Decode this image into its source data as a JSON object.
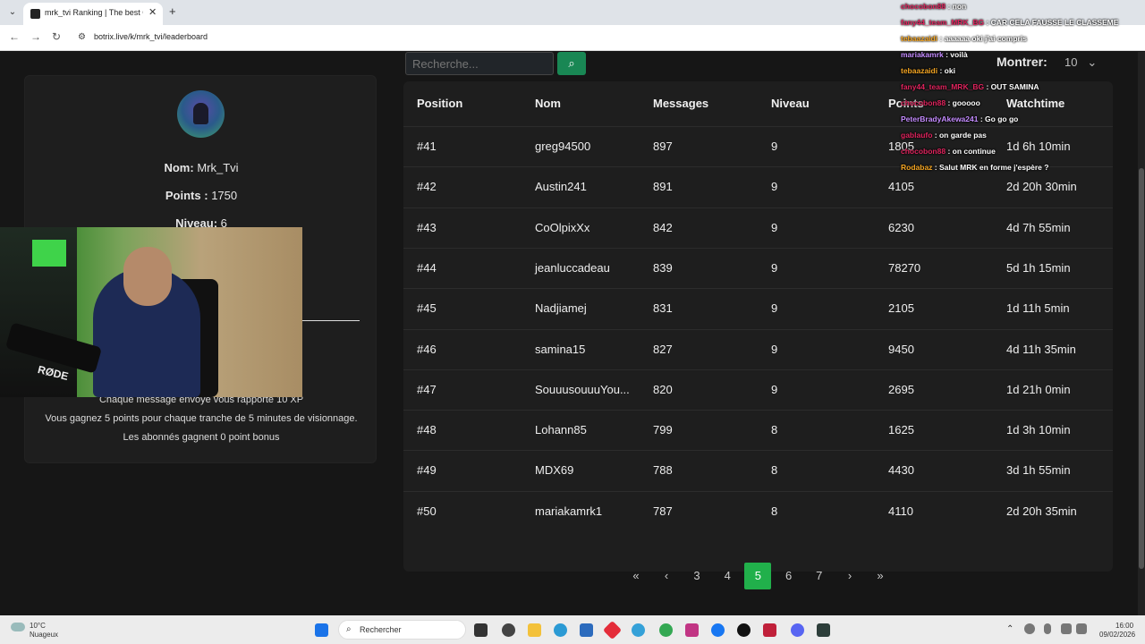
{
  "browser": {
    "tab_title": "mrk_tvi Ranking | The best Cha",
    "tab_close": "✕",
    "new_tab": "+",
    "url": "botrix.live/k/mrk_tvi/leaderboard"
  },
  "search": {
    "placeholder": "Recherche..."
  },
  "show": {
    "label": "Montrer:",
    "value": "10"
  },
  "profile": {
    "name_label": "Nom:",
    "name_value": "Mrk_Tvi",
    "points_label": "Points :",
    "points_value": "1750",
    "level_label": "Niveau:",
    "level_value": "6",
    "info_lines": [
      "Chaque message envoyé vous rapporte 10 XP",
      "Vous gagnez 5 points pour chaque tranche de 5 minutes de visionnage.",
      "Les abonnés gagnent 0 point bonus"
    ]
  },
  "webcam": {
    "mic_label": "RØDE"
  },
  "leaderboard": {
    "headers": [
      "Position",
      "Nom",
      "Messages",
      "Niveau",
      "Points",
      "Watchtime"
    ],
    "rows": [
      [
        "#41",
        "greg94500",
        "897",
        "9",
        "1805",
        "1d 6h 10min"
      ],
      [
        "#42",
        "Austin241",
        "891",
        "9",
        "4105",
        "2d 20h 30min"
      ],
      [
        "#43",
        "CoOlpixXx",
        "842",
        "9",
        "6230",
        "4d 7h 55min"
      ],
      [
        "#44",
        "jeanluccadeau",
        "839",
        "9",
        "78270",
        "5d 1h 15min"
      ],
      [
        "#45",
        "Nadjiamej",
        "831",
        "9",
        "2105",
        "1d 11h 5min"
      ],
      [
        "#46",
        "samina15",
        "827",
        "9",
        "9450",
        "4d 11h 35min"
      ],
      [
        "#47",
        "SouuusouuuYou...",
        "820",
        "9",
        "2695",
        "1d 21h 0min"
      ],
      [
        "#48",
        "Lohann85",
        "799",
        "8",
        "1625",
        "1d 3h 10min"
      ],
      [
        "#49",
        "MDX69",
        "788",
        "8",
        "4430",
        "3d 1h 55min"
      ],
      [
        "#50",
        "mariakamrk1",
        "787",
        "8",
        "4110",
        "2d 20h 35min"
      ]
    ]
  },
  "pagination": {
    "first": "«",
    "prev": "‹",
    "pages": [
      "3",
      "4",
      "5",
      "6",
      "7"
    ],
    "active": "5",
    "next": "›",
    "last": "»"
  },
  "chat": [
    {
      "user": "chocobon88",
      "msg": ": non",
      "color": "#e0245e"
    },
    {
      "user": "fany44_team_MRK_BG",
      "msg": ": CAR CELA FAUSSE LE CLASSEME",
      "color": "#e0245e"
    },
    {
      "user": "tebaazaidi",
      "msg": ": aaaaaa oki j'ai compris",
      "color": "#f5a623"
    },
    {
      "user": "mariakamrk",
      "msg": ": voilà",
      "color": "#c48bff"
    },
    {
      "user": "tebaazaidi",
      "msg": ": oki",
      "color": "#f5a623"
    },
    {
      "user": "fany44_team_MRK_BG",
      "msg": ": OUT SAMINA",
      "color": "#e0245e"
    },
    {
      "user": "chocobon88",
      "msg": ": gooooo",
      "color": "#e0245e"
    },
    {
      "user": "PeterBradyAkewa241",
      "msg": ": Go go go",
      "color": "#c48bff"
    },
    {
      "user": "gablaufo",
      "msg": ": on garde pas",
      "color": "#e0245e"
    },
    {
      "user": "chocobon88",
      "msg": ": on continue",
      "color": "#e0245e"
    },
    {
      "user": "Rodabaz",
      "msg": ": Salut MRK en forme j'espère ?",
      "color": "#f5a623"
    }
  ],
  "taskbar": {
    "weather_temp": "10°C",
    "weather_desc": "Nuageux",
    "search_label": "Rechercher",
    "time": "16:00",
    "date": "09/02/2026"
  },
  "colors": {
    "accent_green": "#21b04b",
    "background": "#161616",
    "card": "#1e1e1e"
  }
}
